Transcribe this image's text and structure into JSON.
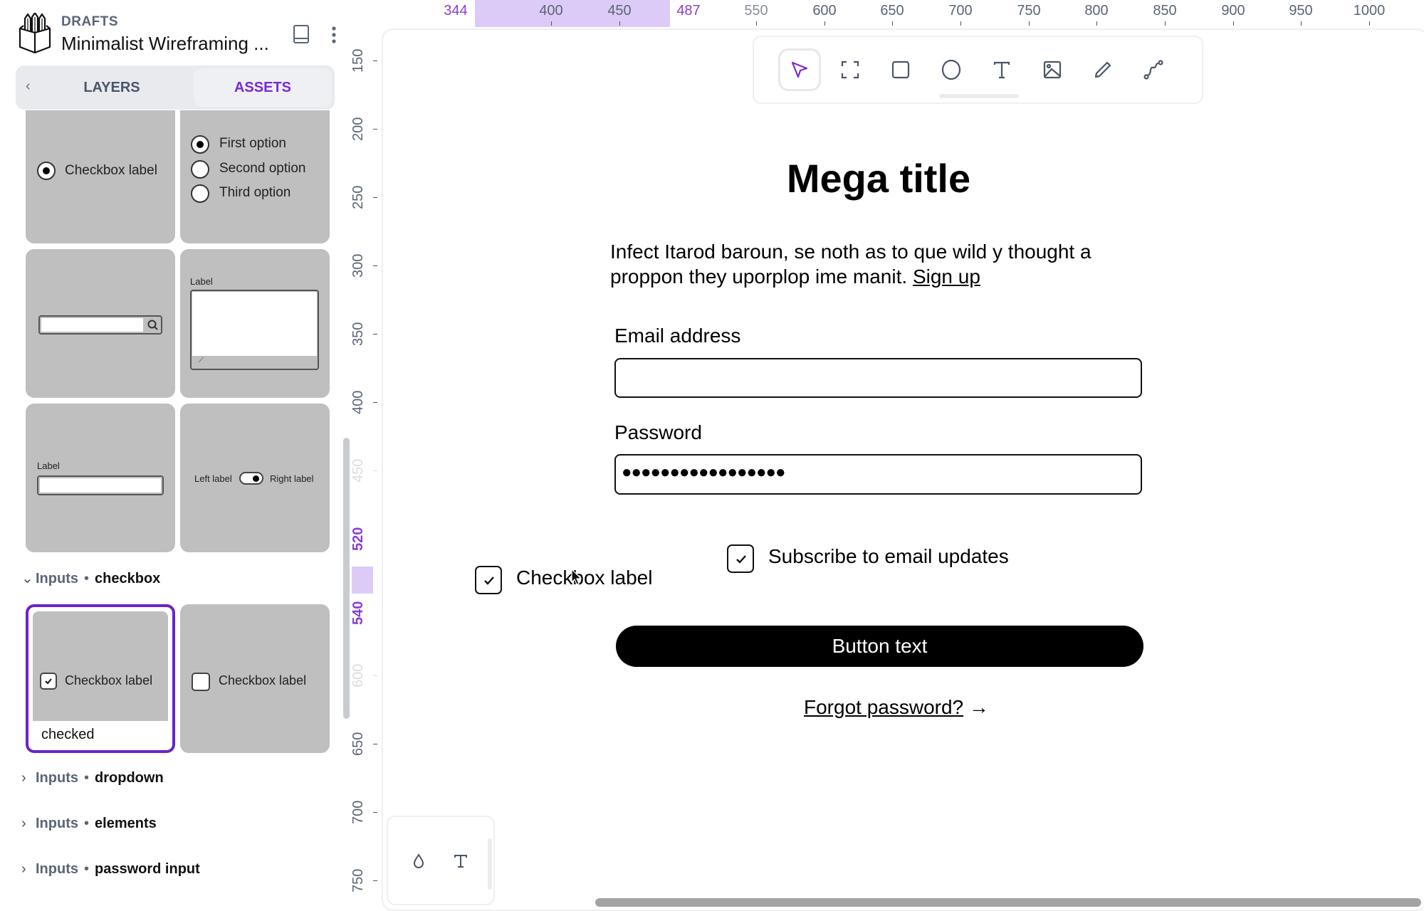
{
  "project": {
    "folder": "DRAFTS",
    "title": "Minimalist Wireframing ..."
  },
  "icons": {
    "logo": "pencil-box-logo-icon",
    "book": "book-icon",
    "more": "more-vertical-icon"
  },
  "panel_tabs": {
    "back_glyph": "‹",
    "items": [
      {
        "label": "LAYERS",
        "active": false
      },
      {
        "label": "ASSETS",
        "active": true
      }
    ]
  },
  "accent_color": "#7a2ad3",
  "asset_cards": {
    "radio_single": {
      "label": "Checkbox label",
      "selected": true
    },
    "radio_group": {
      "options": [
        "First option",
        "Second option",
        "Third option"
      ],
      "selected_index": 0
    },
    "search_input": {
      "icon": "search-icon"
    },
    "textarea": {
      "label": "Label"
    },
    "text_input": {
      "label": "Label"
    },
    "toggle": {
      "left_label": "Left label",
      "right_label": "Right label",
      "on": true
    }
  },
  "sections": [
    {
      "group": "Inputs",
      "name": "checkbox",
      "expanded": true
    },
    {
      "group": "Inputs",
      "name": "dropdown",
      "expanded": false
    },
    {
      "group": "Inputs",
      "name": "elements",
      "expanded": false
    },
    {
      "group": "Inputs",
      "name": "password input",
      "expanded": false
    }
  ],
  "checkbox_variants": [
    {
      "label": "Checkbox label",
      "checked": true,
      "variant_name": "checked",
      "selected": true
    },
    {
      "label": "Checkbox label",
      "checked": false,
      "selected": false
    }
  ],
  "ruler_top": {
    "selection_start": "344",
    "selection_end": "487",
    "ticks": [
      "400",
      "450",
      "550",
      "600",
      "650",
      "700",
      "750",
      "800",
      "850",
      "900",
      "950",
      "1000"
    ]
  },
  "ruler_left": {
    "selection_start": "520",
    "selection_end": "540",
    "ticks": [
      "150",
      "200",
      "250",
      "300",
      "350",
      "400",
      "450",
      "600",
      "650",
      "700",
      "750"
    ]
  },
  "toolbar": {
    "tools": [
      {
        "name": "select",
        "icon": "cursor-arrow-icon",
        "active": true
      },
      {
        "name": "frame",
        "icon": "frame-icon",
        "active": false
      },
      {
        "name": "rectangle",
        "icon": "rectangle-icon",
        "active": false
      },
      {
        "name": "ellipse",
        "icon": "ellipse-icon",
        "active": false
      },
      {
        "name": "text",
        "icon": "text-icon",
        "active": false
      },
      {
        "name": "image",
        "icon": "image-icon",
        "active": false
      },
      {
        "name": "pencil",
        "icon": "pencil-icon",
        "active": false
      },
      {
        "name": "path",
        "icon": "path-icon",
        "active": false
      }
    ]
  },
  "wireframe": {
    "title": "Mega title",
    "paragraph": "Infect Itarod baroun, se noth as to que wild y thought a proppon they uporplop ime manit.",
    "signup_link": "Sign up",
    "email_label": "Email address",
    "email_value": "",
    "password_label": "Password",
    "password_value": "●●●●●●●●●●●●●●●●●",
    "subscribe_label": "Subscribe to email updates",
    "subscribe_checked": true,
    "checkbox_label": "Checkbox label",
    "checkbox_checked": true,
    "button_text": "Button text",
    "forgot_text": "Forgot password?",
    "forgot_arrow": "→"
  },
  "props_panel": {
    "icons": [
      "fill-drop-icon",
      "text-style-icon"
    ],
    "text_glyph": "T"
  }
}
